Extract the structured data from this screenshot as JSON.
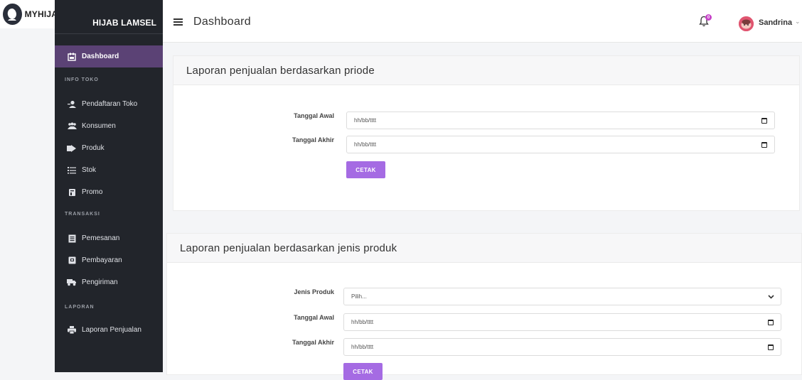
{
  "logo": {
    "text": "MYHIJAB",
    "icon": "hijab-logo-icon"
  },
  "sidebar": {
    "brand": "HIJAB LAMSEL",
    "items": [
      {
        "label": "Dashboard",
        "icon": "dashboard-icon",
        "active": true
      },
      {
        "section": "INFO TOKO"
      },
      {
        "label": "Pendaftaran Toko",
        "icon": "user-plus-icon"
      },
      {
        "label": "Konsumen",
        "icon": "users-icon"
      },
      {
        "label": "Produk",
        "icon": "box-arrow-icon"
      },
      {
        "label": "Stok",
        "icon": "list-icon"
      },
      {
        "label": "Promo",
        "icon": "tag-icon"
      },
      {
        "section": "TRANSAKSI"
      },
      {
        "label": "Pemesanan",
        "icon": "document-icon"
      },
      {
        "label": "Pembayaran",
        "icon": "wallet-icon"
      },
      {
        "label": "Pengiriman",
        "icon": "truck-icon"
      },
      {
        "section": "LAPORAN"
      },
      {
        "label": "Laporan Penjualan",
        "icon": "printer-icon"
      }
    ]
  },
  "topbar": {
    "title": "Dashboard",
    "notification_count": "0",
    "user_name": "Sandrina",
    "chevron": "⌄"
  },
  "card1": {
    "title": "Laporan penjualan berdasarkan priode",
    "start_label": "Tanggal Awal",
    "start_value": "hh/bb/tttt",
    "end_label": "Tanggal Akhir",
    "end_value": "hh/bb/tttt",
    "button": "CETAK"
  },
  "card2": {
    "title": "Laporan penjualan berdasarkan jenis produk",
    "product_label": "Jenis Produk",
    "product_value": "Pilih...",
    "start_label": "Tanggal Awal",
    "start_value": "hh/bb/tttt",
    "end_label": "Tanggal Akhir",
    "end_value": "hh/bb/tttt",
    "button": "CETAK"
  },
  "colors": {
    "accent": "#a56be3",
    "sidebar_bg": "#22252b",
    "active_item": "#5b4275",
    "badge": "#c745c9"
  }
}
